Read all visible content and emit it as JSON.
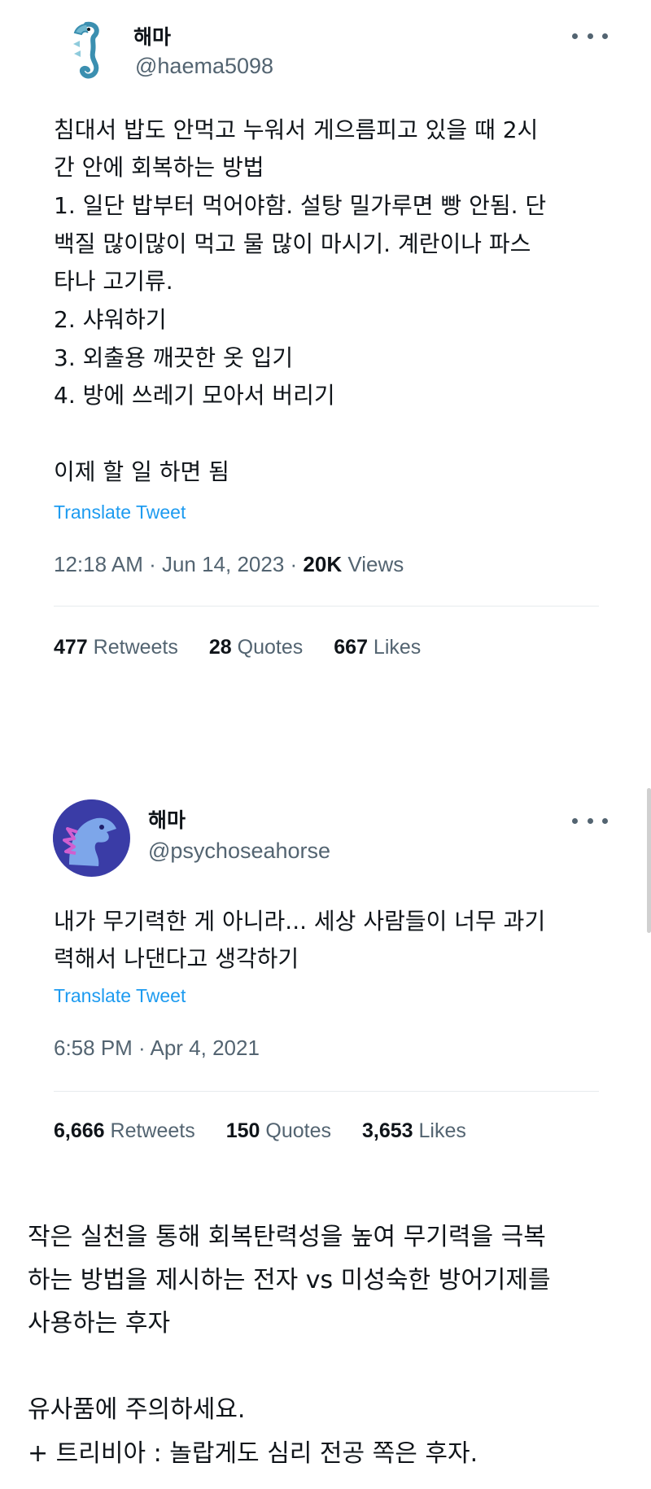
{
  "tweet1": {
    "name": "해마",
    "handle": "@haema5098",
    "avatar_icon": "seahorse-icon",
    "body": [
      "침대서 밥도 안먹고 누워서 게으름피고 있을 때 2시",
      "간 안에 회복하는 방법",
      "1. 일단 밥부터 먹어야함. 설탕 밀가루면 빵 안됨. 단",
      "백질 많이많이 먹고 물 많이 마시기. 계란이나 파스",
      "타나 고기류.",
      "2. 샤워하기",
      "3. 외출용 깨끗한 옷 입기",
      "4. 방에 쓰레기 모아서 버리기",
      "",
      "이제 할 일 하면 됨"
    ],
    "translate": "Translate Tweet",
    "time": "12:18 AM · Jun 14, 2023 · ",
    "views_count": "20K",
    "views_label": " Views",
    "retweets_count": "477",
    "retweets_label": " Retweets",
    "quotes_count": "28",
    "quotes_label": " Quotes",
    "likes_count": "667",
    "likes_label": " Likes"
  },
  "tweet2": {
    "name": "해마",
    "handle": "@psychoseahorse",
    "avatar_icon": "seahorse-dragon-icon",
    "body": [
      "내가 무기력한 게 아니라... 세상 사람들이 너무 과기",
      "력해서 나댄다고 생각하기"
    ],
    "translate": "Translate Tweet",
    "time": "6:58 PM · Apr 4, 2021",
    "retweets_count": "6,666",
    "retweets_label": " Retweets",
    "quotes_count": "150",
    "quotes_label": " Quotes",
    "likes_count": "3,653",
    "likes_label": " Likes"
  },
  "caption": [
    "작은 실천을 통해 회복탄력성을 높여 무기력을 극복",
    "하는 방법을 제시하는 전자 vs 미성숙한 방어기제를",
    "사용하는 후자",
    "",
    "유사품에 주의하세요.",
    "+ 트리비아 : 놀랍게도 심리 전공 쪽은 후자."
  ],
  "colors": {
    "link": "#1d9bf0",
    "secondary_text": "#536471",
    "primary_text": "#0f1419"
  }
}
